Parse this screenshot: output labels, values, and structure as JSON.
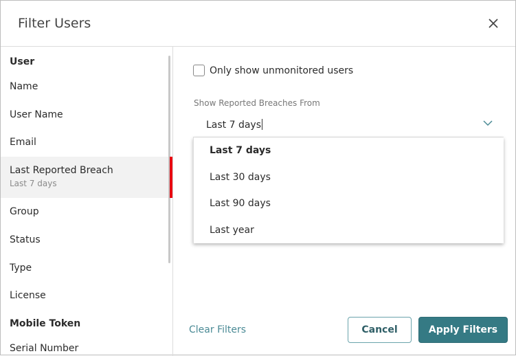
{
  "dialog": {
    "title": "Filter Users"
  },
  "sidebar": {
    "items": [
      {
        "label": "User",
        "heading": true
      },
      {
        "label": "Name"
      },
      {
        "label": "User Name"
      },
      {
        "label": "Email"
      },
      {
        "label": "Last Reported Breach",
        "sub": "Last 7 days",
        "selected": true
      },
      {
        "label": "Group"
      },
      {
        "label": "Status"
      },
      {
        "label": "Type"
      },
      {
        "label": "License"
      },
      {
        "label": "Mobile Token",
        "heading": true
      },
      {
        "label": "Serial Number"
      }
    ]
  },
  "main": {
    "checkbox_label": "Only show unmonitored users",
    "checkbox_checked": false,
    "select_label": "Show Reported Breaches From",
    "select_value": "Last 7 days",
    "options": [
      "Last 7 days",
      "Last 30 days",
      "Last 90 days",
      "Last year"
    ]
  },
  "footer": {
    "clear": "Clear Filters",
    "cancel": "Cancel",
    "apply": "Apply Filters"
  },
  "colors": {
    "accent": "#357a84",
    "selection": "#e8000f"
  }
}
